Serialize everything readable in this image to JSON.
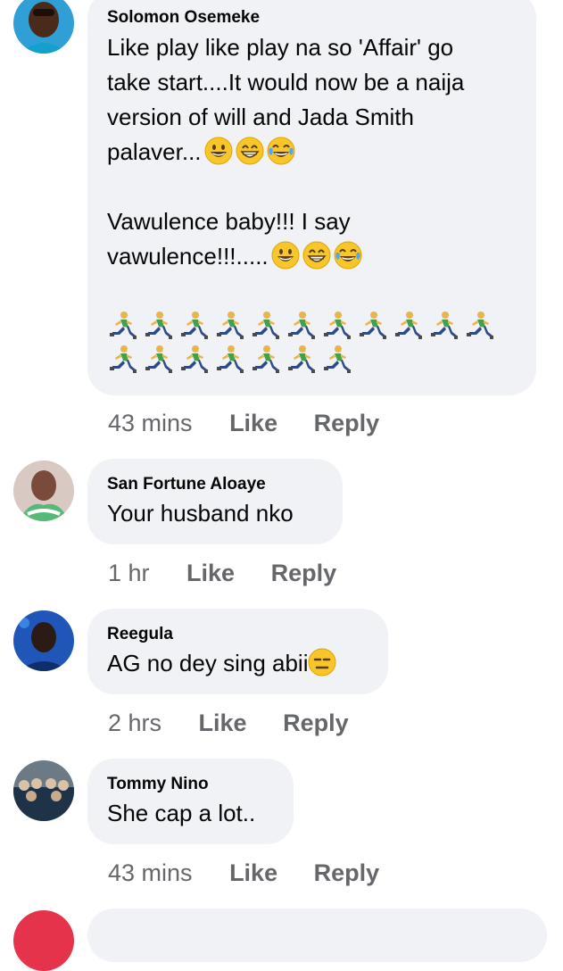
{
  "comments": [
    {
      "author": "Solomon Osemeke",
      "lines": [
        "Like play like play na so 'Affair' go",
        "take start....It would now be a naija",
        "version of will and Jada Smith",
        "palaver..."
      ],
      "line2": [
        "Vawulence baby!!! I say",
        "vawulence!!!....."
      ],
      "time": "43 mins",
      "like": "Like",
      "reply": "Reply",
      "emojis_a": [
        "grinning-face",
        "beaming-face",
        "tears-of-joy-face"
      ],
      "emojis_b": [
        "grinning-face",
        "beaming-face",
        "tears-of-joy-face"
      ],
      "runner_rows": [
        11,
        7
      ]
    },
    {
      "author": "San Fortune Aloaye",
      "text": "Your husband nko",
      "time": "1 hr",
      "like": "Like",
      "reply": "Reply"
    },
    {
      "author": "Reegula",
      "text": "AG no dey sing abii",
      "emoji": "expressionless-face",
      "time": "2 hrs",
      "like": "Like",
      "reply": "Reply"
    },
    {
      "author": "Tommy Nino",
      "text": "She cap a lot..",
      "time": "43 mins",
      "like": "Like",
      "reply": "Reply"
    }
  ],
  "colors": {
    "bubble": "#f0f2f5",
    "meta": "#65676b",
    "text": "#050505"
  }
}
